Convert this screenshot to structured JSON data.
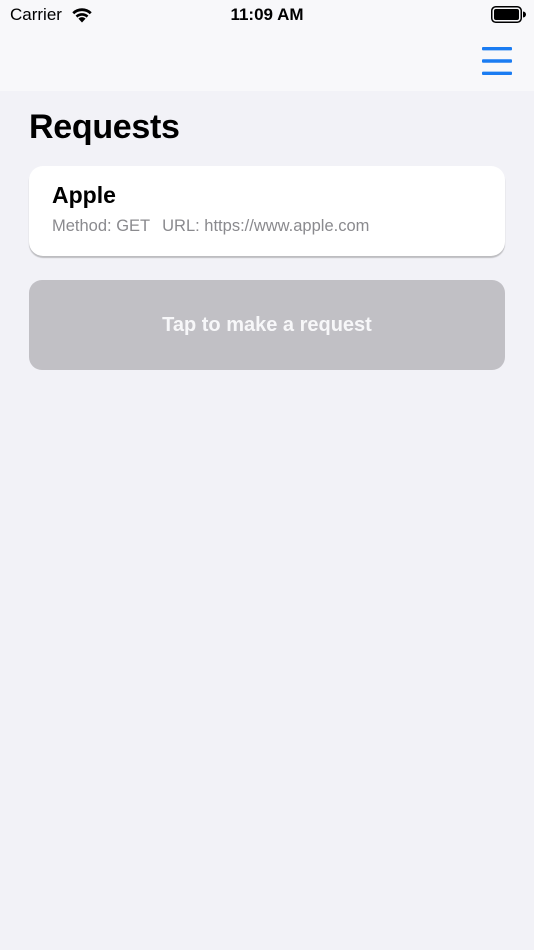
{
  "status_bar": {
    "carrier": "Carrier",
    "time": "11:09 AM"
  },
  "nav_bar": {
    "menu_icon": "hamburger-menu-icon",
    "accent_color": "#1a7cf2"
  },
  "page": {
    "title": "Requests"
  },
  "requests": [
    {
      "name": "Apple",
      "method": "Method: GET",
      "url": "URL: https://www.apple.com"
    }
  ],
  "action": {
    "label": "Tap to make a request",
    "background_color": "#c1c0c5"
  }
}
